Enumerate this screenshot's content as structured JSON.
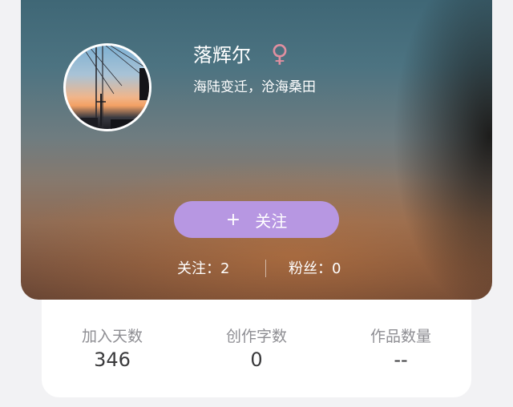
{
  "profile": {
    "name": "落辉尔",
    "gender_icon": "♀",
    "bio": "海陆变迁，沧海桑田"
  },
  "follow_button": {
    "icon": "+",
    "label": "关注"
  },
  "counts": {
    "following": "关注：2",
    "followers": "粉丝：0"
  },
  "stats": [
    {
      "label": "加入天数",
      "value": "346"
    },
    {
      "label": "创作字数",
      "value": "0"
    },
    {
      "label": "作品数量",
      "value": "--"
    }
  ],
  "colors": {
    "follow_button": "#b797e2",
    "gender_icon": "#e08fa0"
  }
}
